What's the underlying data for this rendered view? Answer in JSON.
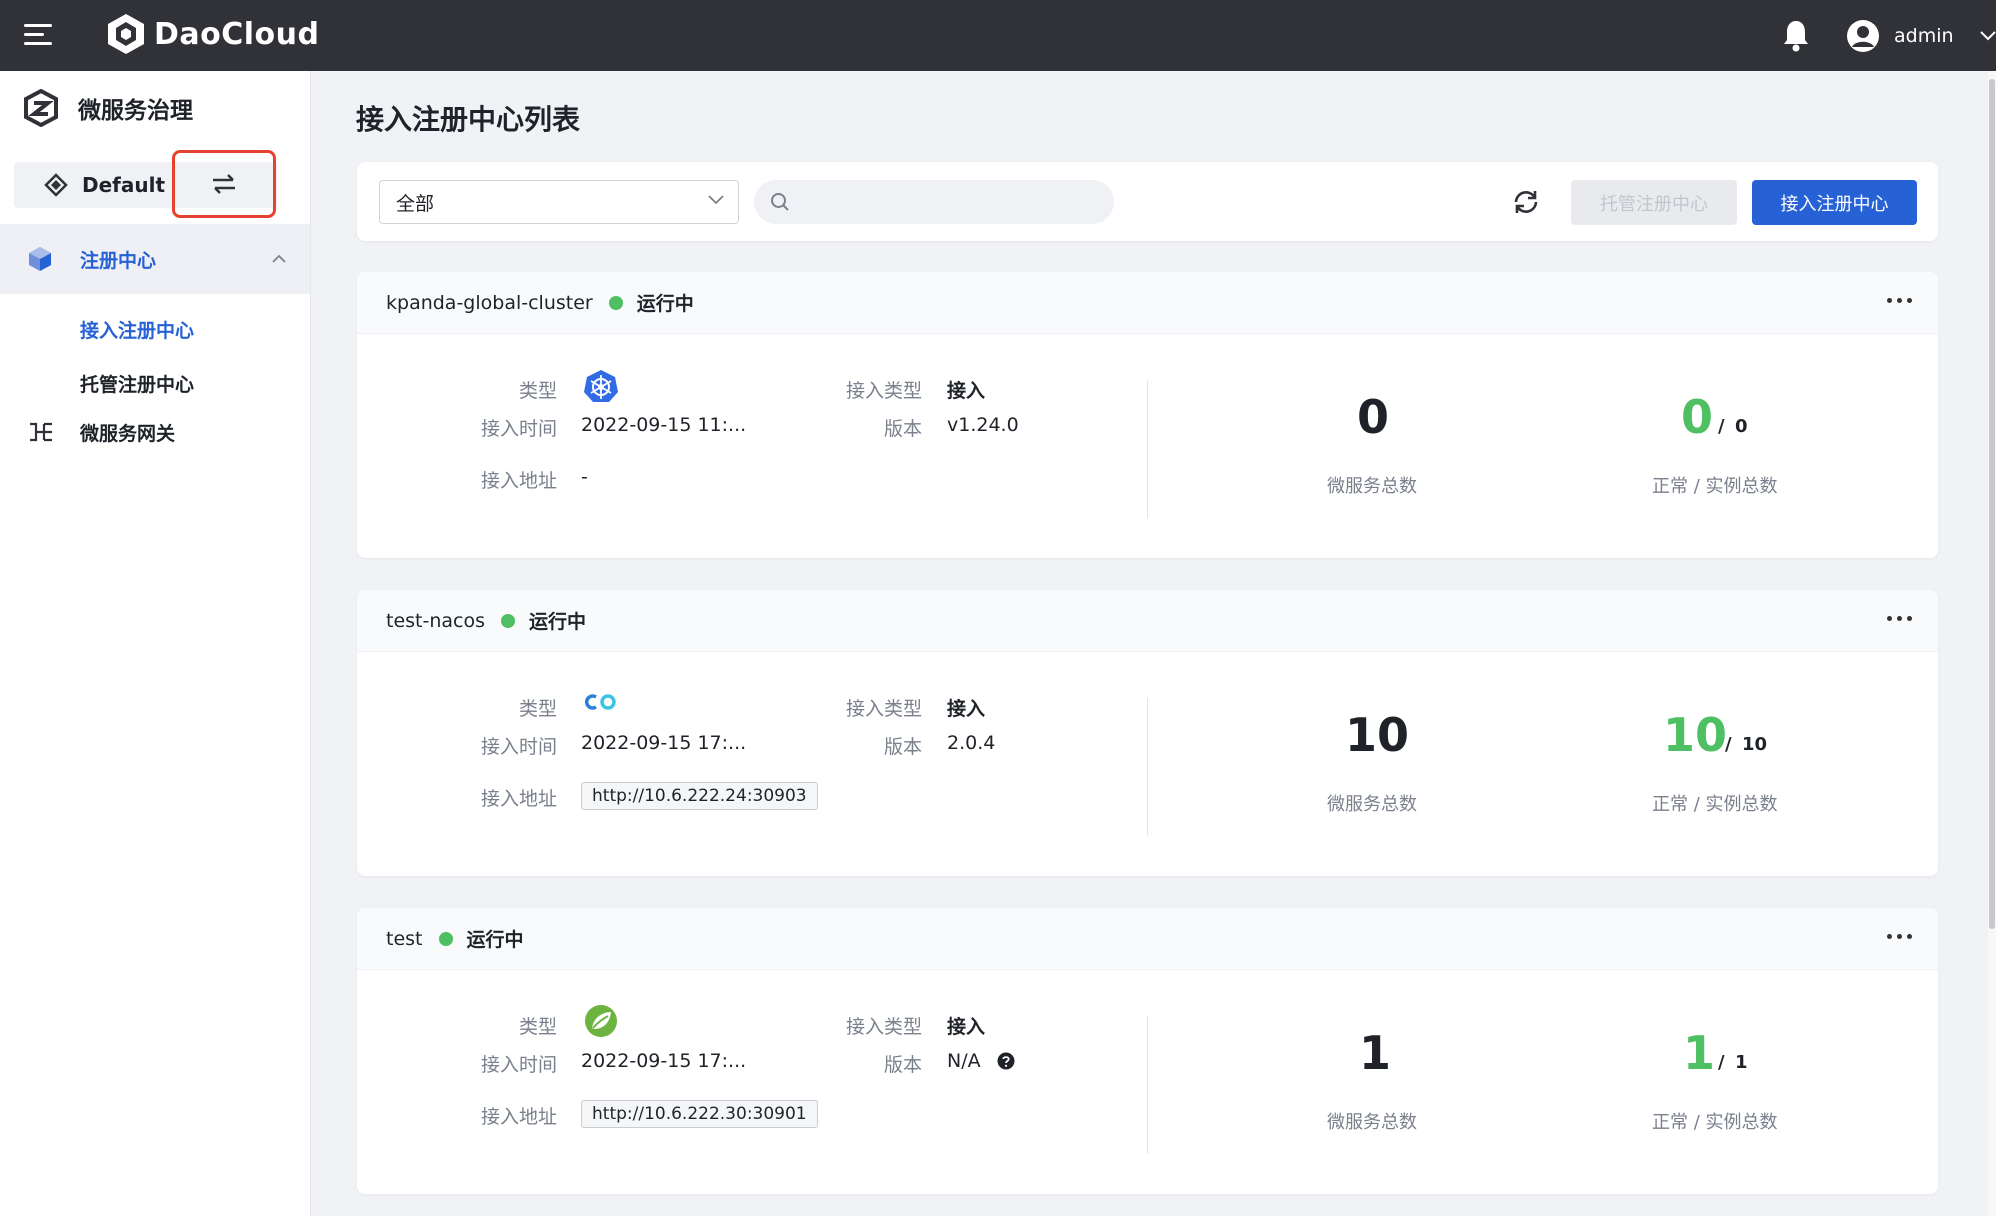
{
  "header": {
    "brand": "DaoCloud",
    "user": "admin"
  },
  "sidebar": {
    "title": "微服务治理",
    "workspace": "Default",
    "nav": [
      {
        "label": "注册中心",
        "active": true
      },
      {
        "label": "接入注册中心",
        "active": true
      },
      {
        "label": "托管注册中心",
        "active": false
      },
      {
        "label": "微服务网关",
        "active": false
      }
    ]
  },
  "main": {
    "title": "接入注册中心列表",
    "filter_value": "全部",
    "search_placeholder": "",
    "btn_managed": "托管注册中心",
    "btn_access": "接入注册中心"
  },
  "labels": {
    "type": "类型",
    "access_time": "接入时间",
    "access_addr": "接入地址",
    "access_type": "接入类型",
    "version": "版本",
    "ms_total": "微服务总数",
    "inst_total": "正常 / 实例总数",
    "slash": "/"
  },
  "cards": [
    {
      "name": "kpanda-global-cluster",
      "status": "运行中",
      "type_icon": "kubernetes-icon",
      "time": "2022-09-15 11:...",
      "addr": "-",
      "access_type": "接入",
      "version": "v1.24.0",
      "ms_total": "0",
      "normal": "0",
      "inst_total": "0"
    },
    {
      "name": "test-nacos",
      "status": "运行中",
      "type_icon": "nacos-icon",
      "time": "2022-09-15 17:...",
      "addr": "http://10.6.222.24:30903",
      "access_type": "接入",
      "version": "2.0.4",
      "ms_total": "10",
      "normal": "10",
      "inst_total": "10"
    },
    {
      "name": "test",
      "status": "运行中",
      "type_icon": "spring-icon",
      "time": "2022-09-15 17:...",
      "addr": "http://10.6.222.30:30901",
      "access_type": "接入",
      "version": "N/A",
      "ms_total": "1",
      "normal": "1",
      "inst_total": "1"
    }
  ],
  "colors": {
    "primary": "#2761d6",
    "success": "#4ec063",
    "highlight": "#e5432f",
    "topbar": "#303237"
  }
}
